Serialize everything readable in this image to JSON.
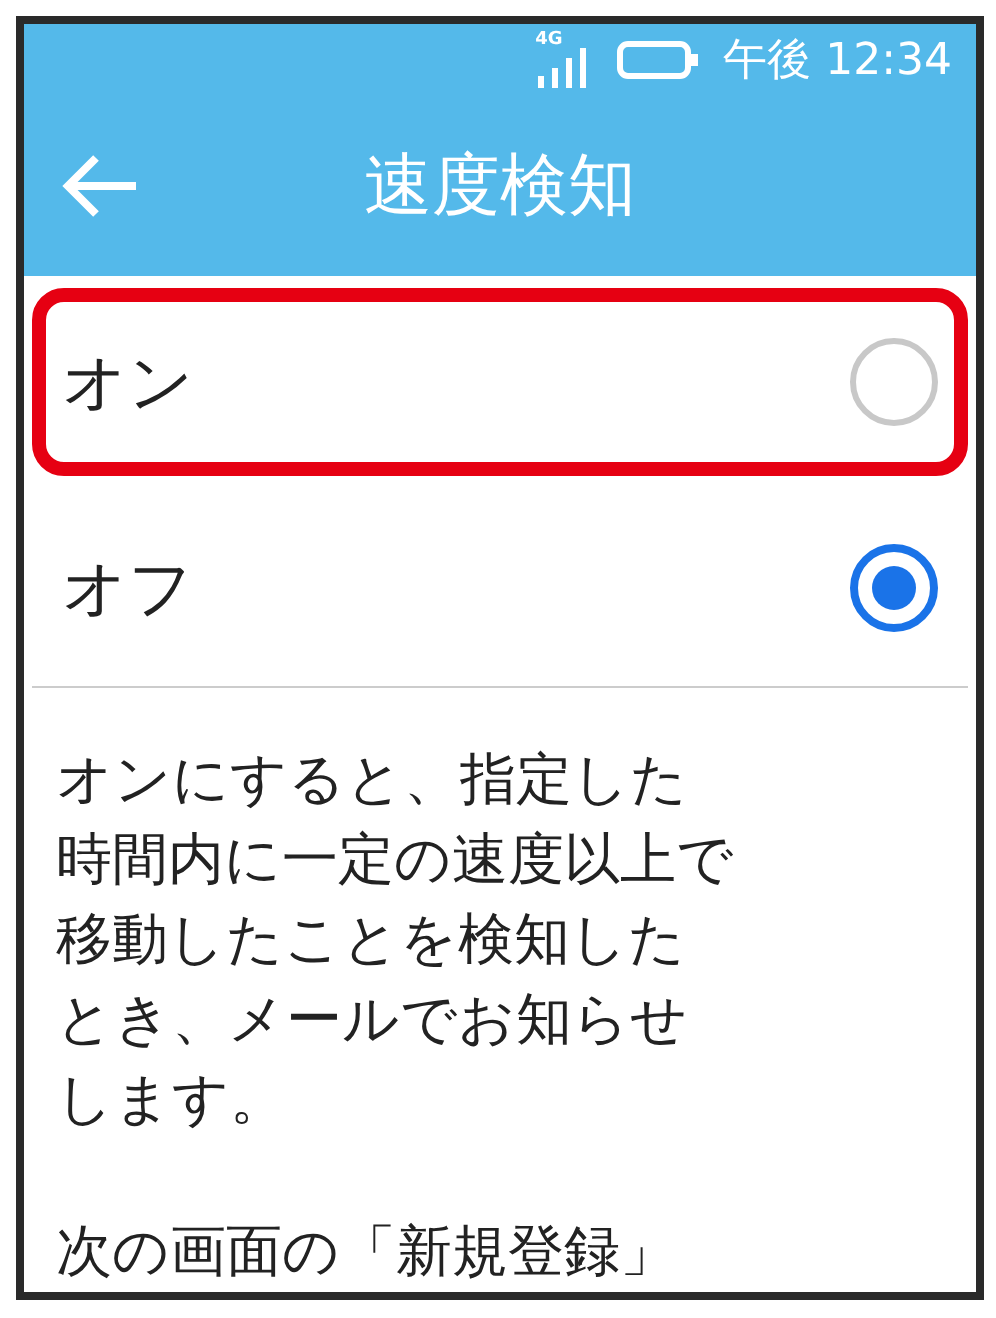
{
  "status_bar": {
    "network": "4G",
    "time": "午後 12:34"
  },
  "header": {
    "title": "速度検知"
  },
  "options": [
    {
      "label": "オン",
      "selected": false,
      "highlighted": true
    },
    {
      "label": "オフ",
      "selected": true,
      "highlighted": false
    }
  ],
  "description": [
    {
      "lines": [
        "オンにすると、指定した",
        "時間内に一定の速度以上で",
        "移動したことを検知した",
        "とき、メールでお知らせ",
        "します。"
      ]
    },
    {
      "lines": [
        "次の画面の「新規登録」"
      ]
    }
  ]
}
